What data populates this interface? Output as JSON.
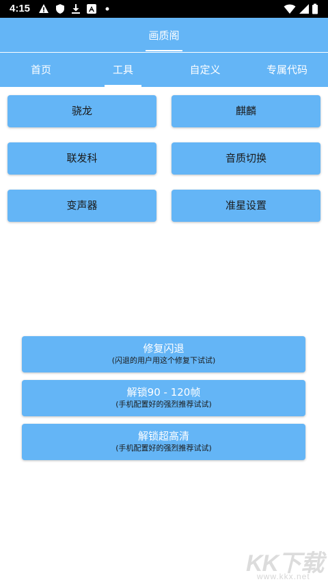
{
  "status_bar": {
    "time": "4:15",
    "left_icons": [
      "warning-icon",
      "shield-icon",
      "download-icon",
      "accessibility-icon",
      "dot-icon"
    ],
    "right_icons": [
      "wifi-icon",
      "signal-icon",
      "battery-icon"
    ]
  },
  "app_bar": {
    "title": "画质阁"
  },
  "tabs": [
    {
      "label": "首页",
      "selected": false
    },
    {
      "label": "工具",
      "selected": true
    },
    {
      "label": "自定义",
      "selected": false
    },
    {
      "label": "专属代码",
      "selected": false
    }
  ],
  "tool_buttons": [
    {
      "label": "骁龙"
    },
    {
      "label": "麒麟"
    },
    {
      "label": "联发科"
    },
    {
      "label": "音质切换"
    },
    {
      "label": "变声器"
    },
    {
      "label": "准星设置"
    }
  ],
  "action_buttons": [
    {
      "title": "修复闪退",
      "subtitle": "(闪退的用户用这个修复下试试)"
    },
    {
      "title": "解锁90 - 120帧",
      "subtitle": "(手机配置好的强烈推荐试试)"
    },
    {
      "title": "解锁超高清",
      "subtitle": "(手机配置好的强烈推荐试试)"
    }
  ],
  "watermark": {
    "brand": "KK下载",
    "url": "www.kkx.net"
  },
  "colors": {
    "primary": "#64b5f6",
    "status_bar": "#000000",
    "background": "#ffffff"
  }
}
